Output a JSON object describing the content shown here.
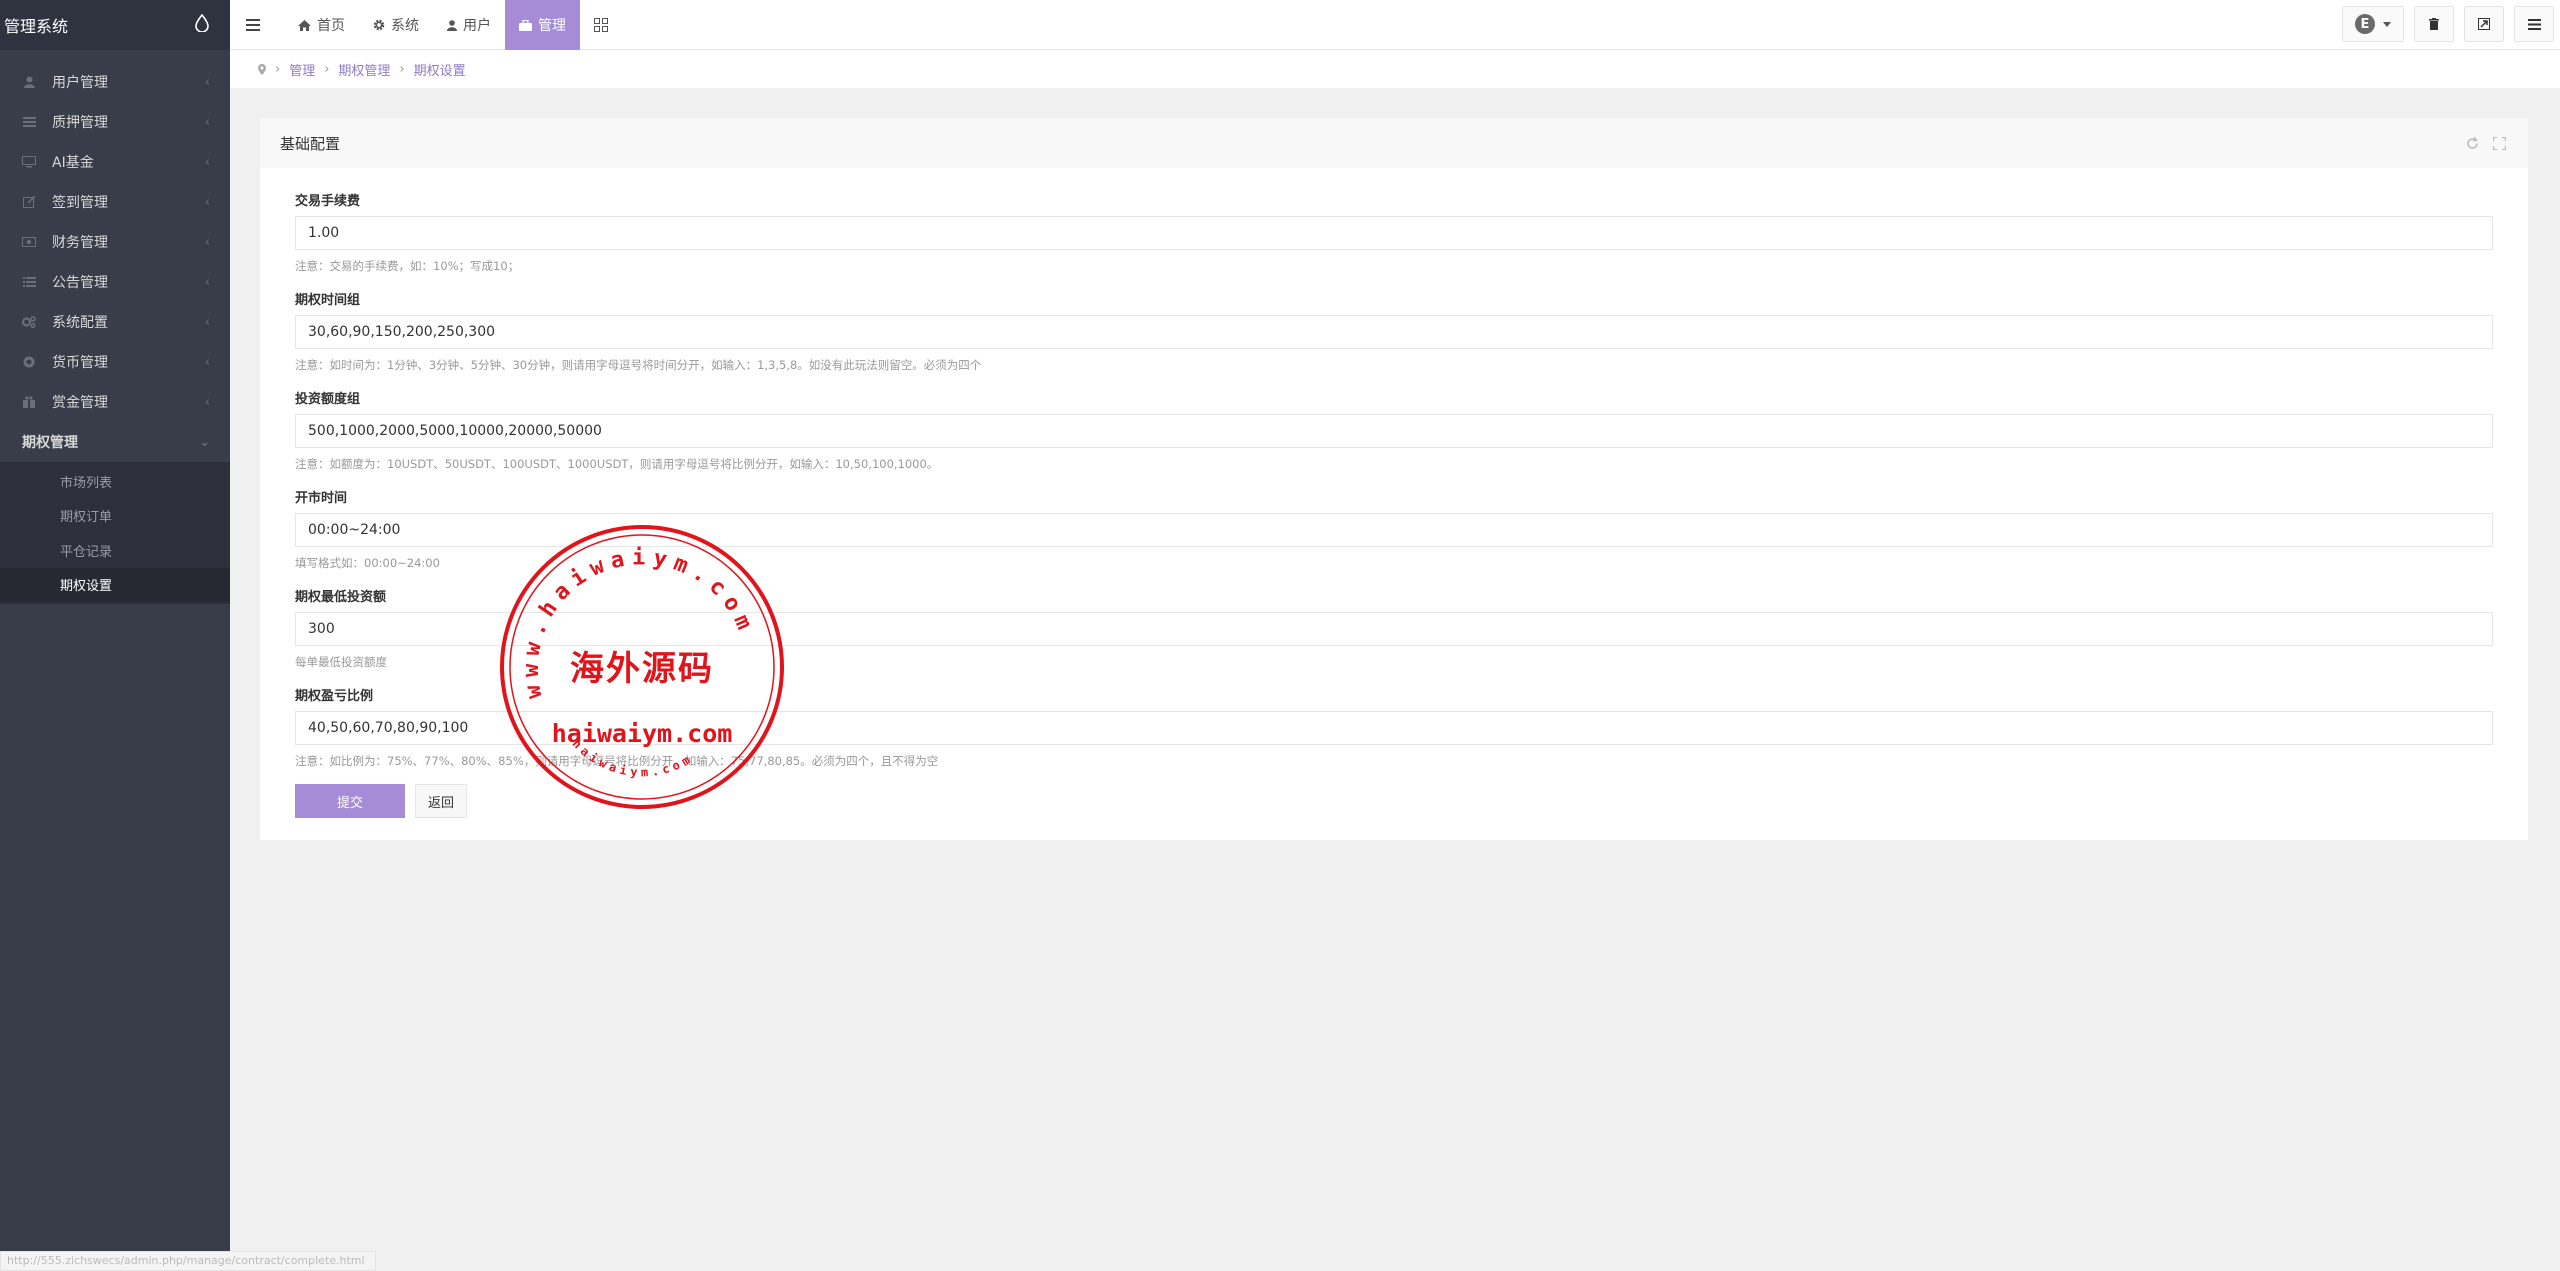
{
  "app": {
    "title": "管理系统"
  },
  "sidebar": {
    "items": [
      {
        "label": "用户管理",
        "icon": "user-icon"
      },
      {
        "label": "质押管理",
        "icon": "list-icon"
      },
      {
        "label": "AI基金",
        "icon": "desktop-icon"
      },
      {
        "label": "签到管理",
        "icon": "edit-icon"
      },
      {
        "label": "财务管理",
        "icon": "money-icon"
      },
      {
        "label": "公告管理",
        "icon": "list-icon"
      },
      {
        "label": "系统配置",
        "icon": "gears-icon"
      },
      {
        "label": "货币管理",
        "icon": "coin-icon"
      },
      {
        "label": "赏金管理",
        "icon": "gift-icon"
      }
    ],
    "open_item": {
      "label": "期权管理"
    },
    "sub_items": [
      {
        "label": "市场列表"
      },
      {
        "label": "期权订单"
      },
      {
        "label": "平仓记录"
      },
      {
        "label": "期权设置"
      }
    ]
  },
  "topbar": {
    "tabs": [
      {
        "label": "首页",
        "icon": "home-icon"
      },
      {
        "label": "系统",
        "icon": "gear-icon"
      },
      {
        "label": "用户",
        "icon": "user-icon"
      },
      {
        "label": "管理",
        "icon": "briefcase-icon"
      }
    ],
    "active_tab": "管理",
    "avatar_letter": "E"
  },
  "breadcrumb": {
    "items": [
      "管理",
      "期权管理",
      "期权设置"
    ]
  },
  "panel": {
    "title": "基础配置",
    "fields": [
      {
        "label": "交易手续费",
        "value": "1.00",
        "help": "注意：交易的手续费，如：10%；写成10；"
      },
      {
        "label": "期权时间组",
        "value": "30,60,90,150,200,250,300",
        "help": "注意：如时间为：1分钟、3分钟、5分钟、30分钟，则请用字母逗号将时间分开，如输入：1,3,5,8。如没有此玩法则留空。必须为四个"
      },
      {
        "label": "投资额度组",
        "value": "500,1000,2000,5000,10000,20000,50000",
        "help": "注意：如额度为：10USDT、50USDT、100USDT、1000USDT，则请用字母逗号将比例分开，如输入：10,50,100,1000。"
      },
      {
        "label": "开市时间",
        "value": "00:00~24:00",
        "help": "填写格式如：00:00~24:00"
      },
      {
        "label": "期权最低投资额",
        "value": "300",
        "help": "每单最低投资额度"
      },
      {
        "label": "期权盈亏比例",
        "value": "40,50,60,70,80,90,100",
        "help": "注意：如比例为：75%、77%、80%、85%，则请用字母逗号将比例分开，如输入：75,77,80,85。必须为四个，且不得为空"
      }
    ],
    "submit_label": "提交",
    "back_label": "返回"
  },
  "stamp": {
    "ring_text": "www.haiwaiym.com",
    "center_text": "海外源码",
    "domain_text": "haiwaiym.com",
    "small_text": "haiwaiym.com",
    "color": "#e0141b"
  },
  "status_url": "http://555.zichswecs/admin.php/manage/contract/complete.html",
  "colors": {
    "accent": "#a68cd7",
    "sidebar_bg": "#393d49"
  }
}
